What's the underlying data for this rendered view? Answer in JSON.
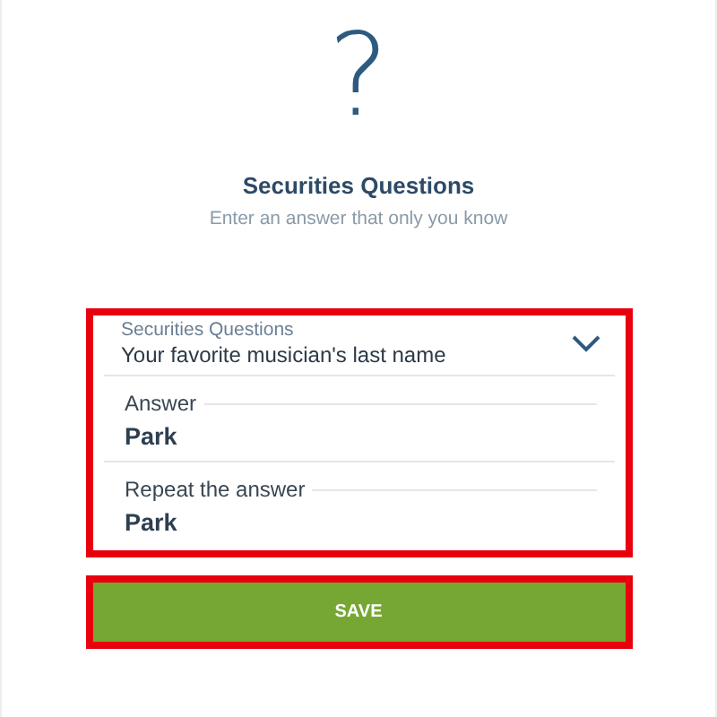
{
  "header": {
    "glyph": "?",
    "title": "Securities Questions",
    "subtitle": "Enter an answer that only you know"
  },
  "form": {
    "highlighted": true,
    "question": {
      "label": "Securities Questions",
      "value": "Your favorite musician's last name"
    },
    "fields": [
      {
        "label": "Answer",
        "value": "Park"
      },
      {
        "label": "Repeat the answer",
        "value": "Park"
      }
    ]
  },
  "save": {
    "label": "SAVE",
    "highlighted": true
  }
}
